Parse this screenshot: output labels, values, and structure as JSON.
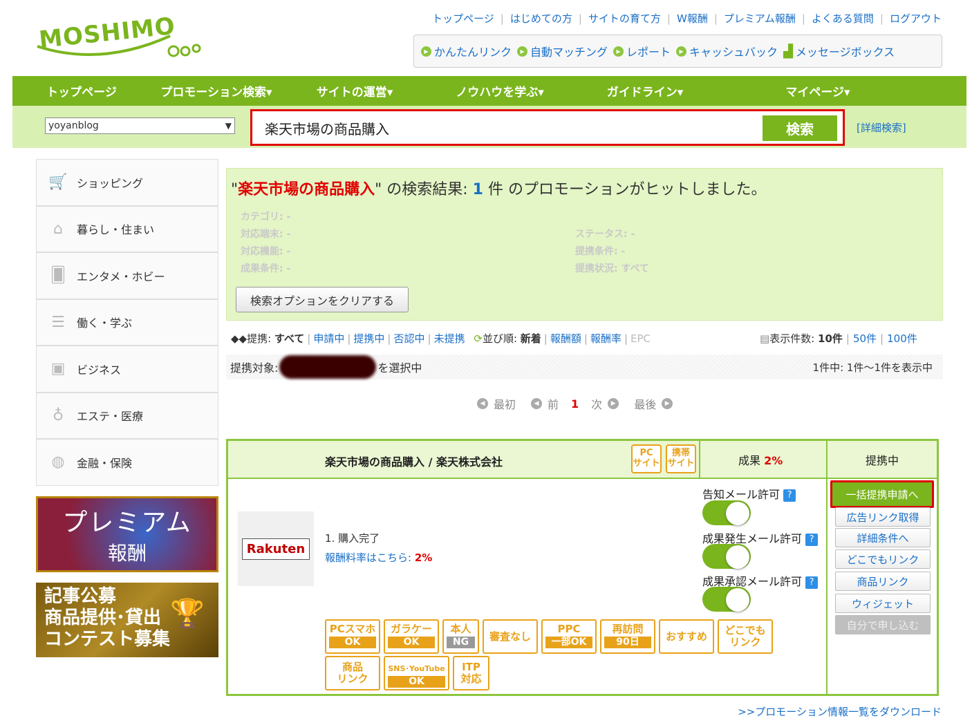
{
  "header": {
    "logo": "MOSHIMO",
    "top_links": [
      "トップページ",
      "はじめての方",
      "サイトの育て方",
      "W報酬",
      "プレミアム報酬",
      "よくある質問",
      "ログアウト"
    ],
    "sub_links": [
      "かんたんリンク",
      "自動マッチング",
      "レポート",
      "キャッシュバック",
      "メッセージボックス"
    ]
  },
  "nav": [
    "トップページ",
    "プロモーション検索▾",
    "サイトの運営▾",
    "ノウハウを学ぶ▾",
    "ガイドライン▾",
    "マイページ▾"
  ],
  "search": {
    "site": "yoyanblog",
    "query": "楽天市場の商品購入",
    "button": "検索",
    "advanced": "[詳細検索]"
  },
  "sidebar": {
    "categories": [
      "ショッピング",
      "暮らし・住まい",
      "エンタメ・ホビー",
      "働く・学ぶ",
      "ビジネス",
      "エステ・医療",
      "金融・保険"
    ],
    "banner1_line1": "プレミアム",
    "banner1_line2": "報酬",
    "banner2_line1": "記事公募",
    "banner2_line2": "商品提供･貸出",
    "banner2_line3": "コンテスト募集"
  },
  "result": {
    "q_open": "\"",
    "keyword": "楽天市場の商品購入",
    "q_close": "\"",
    "text1": " の検索結果: ",
    "count": "1",
    "text2": " 件 のプロモーションがヒットしました。",
    "options_left": [
      "カテゴリ: -",
      "対応端末: -",
      "対応機能: -",
      "成果条件: -"
    ],
    "options_right": [
      "ステータス: -",
      "提携条件: -",
      "提携状況: すべて"
    ],
    "clear_button": "検索オプションをクリアする"
  },
  "filters": {
    "partner_label": "提携: ",
    "all": "すべて",
    "items": [
      "申請中",
      "提携中",
      "否認中",
      "未提携"
    ],
    "sort_label": "並び順: ",
    "sort_new": "新着",
    "sort_items": [
      "報酬額",
      "報酬率"
    ],
    "sort_disabled": "EPC",
    "count_label": "表示件数: ",
    "count_current": "10件",
    "count_items": [
      "50件",
      "100件"
    ]
  },
  "target": {
    "label": "提携対象: ",
    "suffix": "を選択中",
    "range": "1件中: 1件〜1件を表示中"
  },
  "pager": {
    "first": "最初",
    "prev": "前",
    "current": "1",
    "next": "次",
    "last": "最後"
  },
  "promotion": {
    "name": "楽天市場の商品購入 / 楽天株式会社",
    "tag_pc": "PC\nサイト",
    "tag_mobile": "携帯\nサイト",
    "reward_label": "成果 ",
    "reward_value": "2%",
    "status": "提携中",
    "logo": "Rakuten",
    "step": "1. 購入完了",
    "rate_label": "報酬料率はこちら: ",
    "rate_value": "2%",
    "mail": [
      "告知メール許可",
      "成果発生メール許可",
      "成果承認メール許可"
    ],
    "help": "?",
    "badges": [
      {
        "t": "PCスマホ",
        "o": "OK"
      },
      {
        "t": "ガラケー",
        "o": "OK"
      },
      {
        "t": "本人",
        "o": "NG"
      },
      {
        "t": "審査なし",
        "o": ""
      },
      {
        "t": "PPC",
        "o": "一部OK"
      },
      {
        "t": "再訪問",
        "o": "90日"
      },
      {
        "t": "おすすめ",
        "o": ""
      },
      {
        "t": "どこでも\nリンク",
        "o": ""
      },
      {
        "t": "商品\nリンク",
        "o": ""
      },
      {
        "t": "SNS･YouTube",
        "o": "OK"
      },
      {
        "t": "ITP\n対応",
        "o": ""
      }
    ],
    "actions": [
      "一括提携申請へ",
      "広告リンク取得",
      "詳細条件へ",
      "どこでもリンク",
      "商品リンク",
      "ウィジェット",
      "自分で申し込む"
    ]
  },
  "download": ">>プロモーション情報一覧をダウンロード"
}
